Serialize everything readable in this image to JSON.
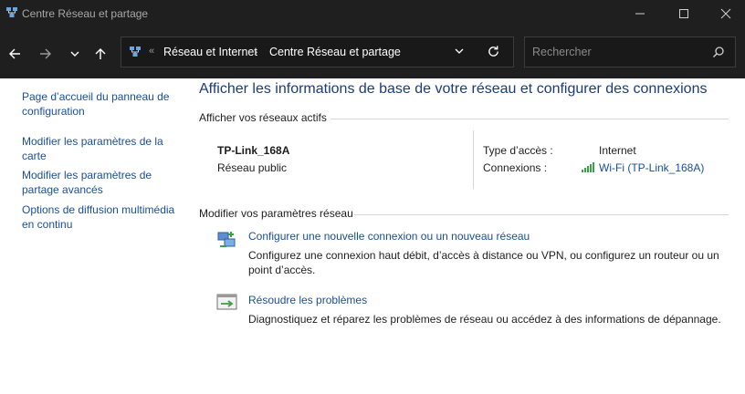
{
  "window": {
    "title": "Centre Réseau et partage"
  },
  "address": {
    "crumbs": [
      "Réseau et Internet",
      "Centre Réseau et partage"
    ],
    "overflow": "«",
    "separator": "›"
  },
  "search": {
    "placeholder": "Rechercher"
  },
  "sidebar": {
    "items": [
      {
        "label": "Page d’accueil du panneau de configuration"
      },
      {
        "label": "Modifier les paramètres de la carte"
      },
      {
        "label": "Modifier les paramètres de partage avancés"
      },
      {
        "label": "Options de diffusion multimédia en continu"
      }
    ]
  },
  "main": {
    "heading": "Afficher les informations de base de votre réseau et configurer des connexions",
    "active_section": "Afficher vos réseaux actifs",
    "network": {
      "name": "TP-Link_168A",
      "profile": "Réseau public",
      "access_label": "Type d’accès :",
      "access_value": "Internet",
      "connections_label": "Connexions :",
      "connections_value": "Wi-Fi (TP-Link_168A)"
    },
    "settings_section": "Modifier vos paramètres réseau",
    "tasks": [
      {
        "title": "Configurer une nouvelle connexion ou un nouveau réseau",
        "desc": "Configurez une connexion haut débit, d’accès à distance ou VPN, ou configurez un routeur ou un point d’accès.",
        "icon": "new-connection-icon"
      },
      {
        "title": "Résoudre les problèmes",
        "desc": "Diagnostiquez et réparez les problèmes de réseau ou accédez à des informations de dépannage.",
        "icon": "troubleshoot-icon"
      }
    ]
  },
  "colors": {
    "link": "#1a4e98",
    "heading": "#1b3c79",
    "chrome": "#1f1f1f",
    "signal": "#3aa14a"
  }
}
